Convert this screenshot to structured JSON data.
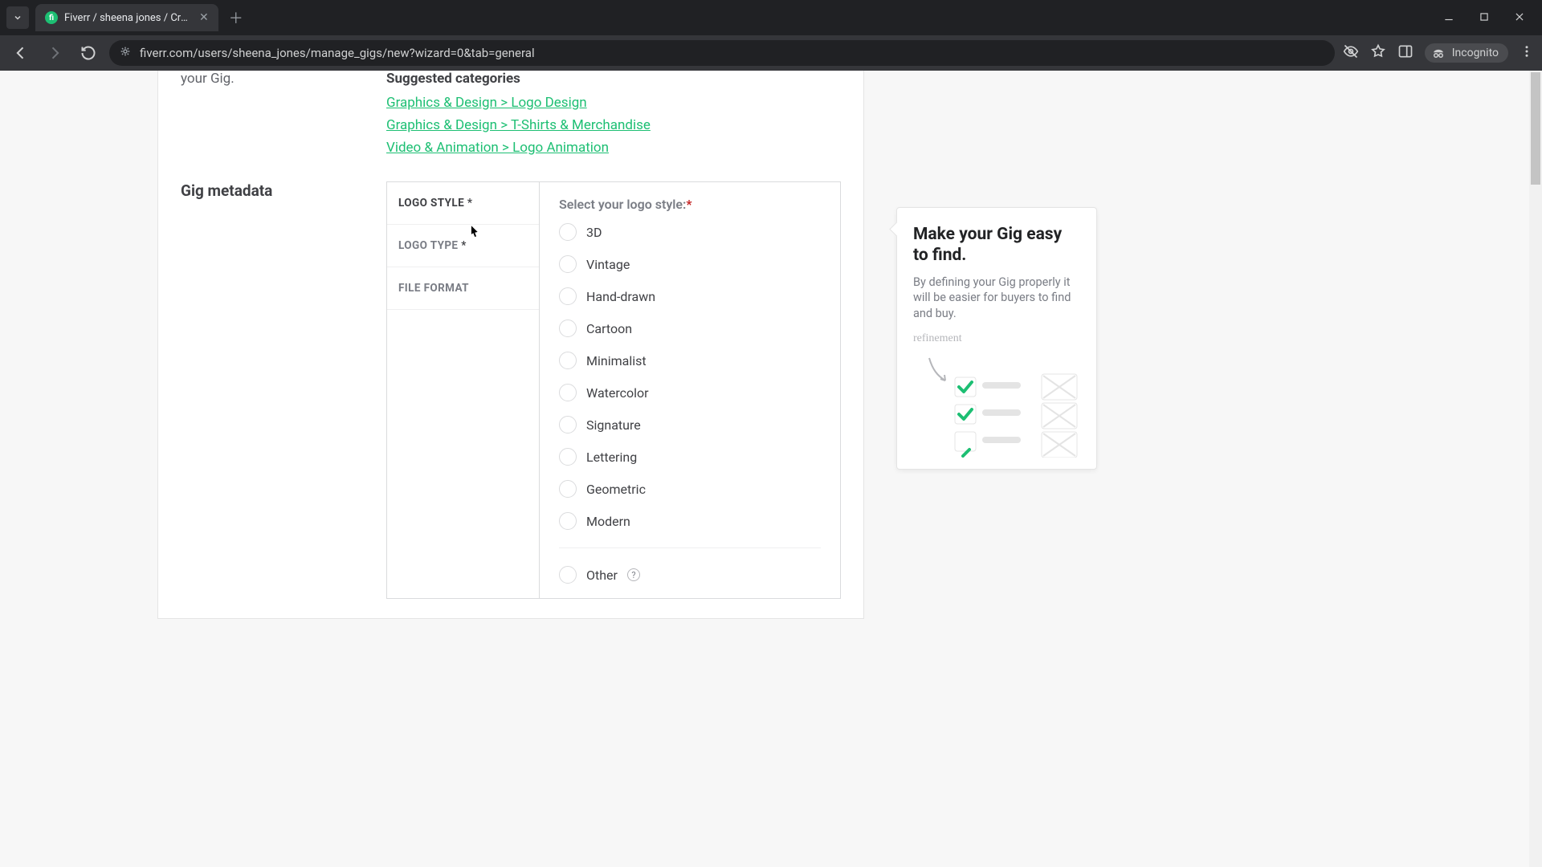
{
  "browser": {
    "tab_title": "Fiverr / sheena jones / Create a",
    "url": "fiverr.com/users/sheena_jones/manage_gigs/new?wizard=0&tab=general",
    "incognito_label": "Incognito"
  },
  "page": {
    "truncated_line": "your Gig.",
    "suggested_heading": "Suggested categories",
    "suggested_links": [
      "Graphics & Design > Logo Design",
      "Graphics & Design > T-Shirts & Merchandise",
      "Video & Animation > Logo Animation"
    ],
    "metadata_label": "Gig metadata",
    "meta_tabs": [
      {
        "label": "LOGO STYLE",
        "required": true,
        "active": true
      },
      {
        "label": "LOGO TYPE",
        "required": true,
        "active": false
      },
      {
        "label": "FILE FORMAT",
        "required": false,
        "active": false
      }
    ],
    "pane_title": "Select your logo style:",
    "options": [
      "3D",
      "Vintage",
      "Hand-drawn",
      "Cartoon",
      "Minimalist",
      "Watercolor",
      "Signature",
      "Lettering",
      "Geometric",
      "Modern"
    ],
    "option_other": "Other"
  },
  "tip": {
    "title": "Make your Gig easy to find.",
    "body": "By defining your Gig properly it will be easier for buyers to find and buy.",
    "scribble": "refinement"
  }
}
